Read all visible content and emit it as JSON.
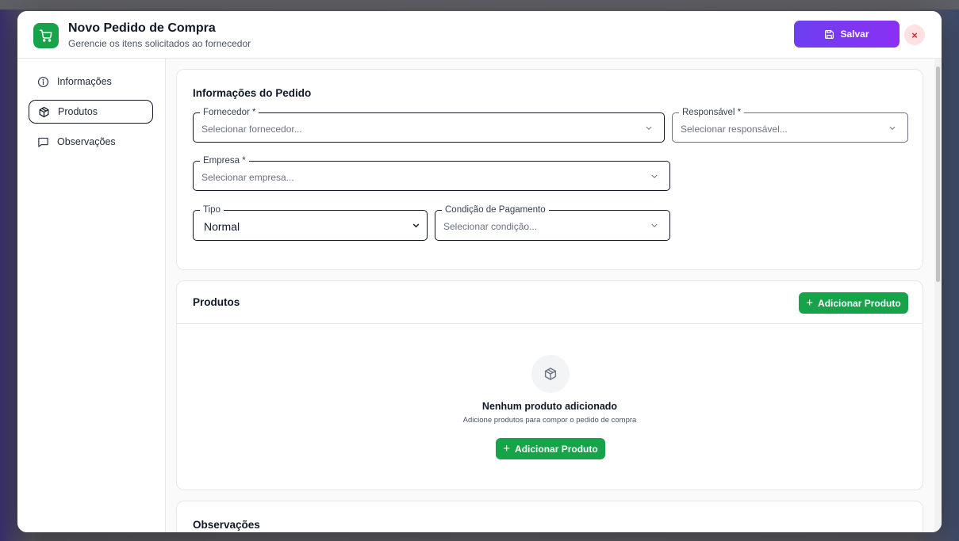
{
  "header": {
    "title": "Novo Pedido de Compra",
    "subtitle": "Gerencie os itens solicitados ao fornecedor",
    "save_label": "Salvar",
    "close_label": "×"
  },
  "sidebar": {
    "items": [
      {
        "label": "Informações",
        "icon": "info-icon",
        "active": false
      },
      {
        "label": "Produtos",
        "icon": "package-icon",
        "active": true
      },
      {
        "label": "Observações",
        "icon": "message-icon",
        "active": false
      }
    ]
  },
  "info_card": {
    "title": "Informações do Pedido",
    "fornecedor": {
      "label": "Fornecedor *",
      "placeholder": "Selecionar fornecedor..."
    },
    "responsavel": {
      "label": "Responsável *",
      "placeholder": "Selecionar responsável..."
    },
    "empresa": {
      "label": "Empresa *",
      "placeholder": "Selecionar empresa..."
    },
    "tipo": {
      "label": "Tipo",
      "value": "Normal"
    },
    "condicao": {
      "label": "Condição de Pagamento",
      "placeholder": "Selecionar condição..."
    }
  },
  "products_card": {
    "title": "Produtos",
    "add_label": "Adicionar Produto",
    "empty_title": "Nenhum produto adicionado",
    "empty_subtitle": "Adicione produtos para compor o pedido de compra",
    "empty_add_label": "Adicionar Produto"
  },
  "notes_card": {
    "title": "Observações"
  },
  "colors": {
    "primary_green": "#16a34a",
    "save_gradient_start": "#6d3ff0",
    "save_gradient_end": "#8b2ff5",
    "close_bg": "#fde2e4",
    "close_fg": "#dc2626"
  }
}
